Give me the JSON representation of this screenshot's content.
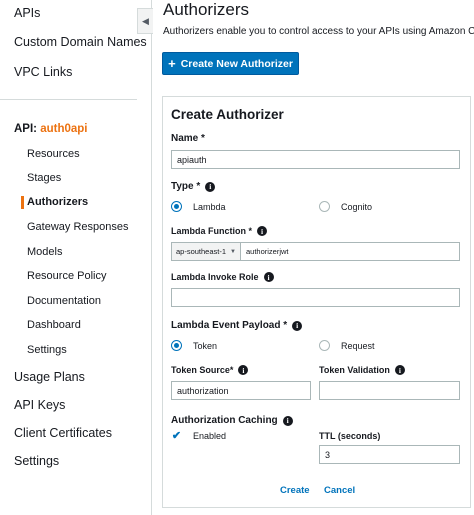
{
  "sidebar": {
    "top_items": [
      {
        "label": "APIs"
      },
      {
        "label": "Custom Domain Names"
      },
      {
        "label": "VPC Links"
      }
    ],
    "api_prefix": "API:",
    "api_name": "auth0api",
    "sub_items": [
      {
        "label": "Resources"
      },
      {
        "label": "Stages"
      },
      {
        "label": "Authorizers",
        "active": true
      },
      {
        "label": "Gateway Responses"
      },
      {
        "label": "Models"
      },
      {
        "label": "Resource Policy"
      },
      {
        "label": "Documentation"
      },
      {
        "label": "Dashboard"
      },
      {
        "label": "Settings"
      }
    ],
    "bottom_items": [
      {
        "label": "Usage Plans"
      },
      {
        "label": "API Keys"
      },
      {
        "label": "Client Certificates"
      },
      {
        "label": "Settings"
      }
    ],
    "collapse_icon": "◀"
  },
  "header": {
    "title": "Authorizers",
    "description": "Authorizers enable you to control access to your APIs using Amazon Cog",
    "create_button": "Create New Authorizer"
  },
  "form": {
    "title": "Create Authorizer",
    "name_label": "Name *",
    "name_value": "apiauth",
    "type_label": "Type *",
    "type_options": [
      {
        "label": "Lambda",
        "selected": true
      },
      {
        "label": "Cognito",
        "selected": false
      }
    ],
    "lambda_function_label": "Lambda Function *",
    "region_value": "ap-southeast-1",
    "function_value": "authorizerjwt",
    "invoke_role_label": "Lambda Invoke Role",
    "invoke_role_value": "",
    "payload_label": "Lambda Event Payload *",
    "payload_options": [
      {
        "label": "Token",
        "selected": true
      },
      {
        "label": "Request",
        "selected": false
      }
    ],
    "token_source_label": "Token Source*",
    "token_source_value": "authorization",
    "token_validation_label": "Token Validation",
    "token_validation_value": "",
    "caching_label": "Authorization Caching",
    "caching_enabled_label": "Enabled",
    "caching_enabled": true,
    "ttl_label": "TTL (seconds)",
    "ttl_value": "3",
    "create_label": "Create",
    "cancel_label": "Cancel"
  },
  "icons": {
    "info": "i",
    "check": "✔",
    "plus": "+",
    "caret": "▼"
  },
  "colors": {
    "accent": "#0073bb",
    "active": "#ec7211",
    "border": "#d5dbdb"
  }
}
